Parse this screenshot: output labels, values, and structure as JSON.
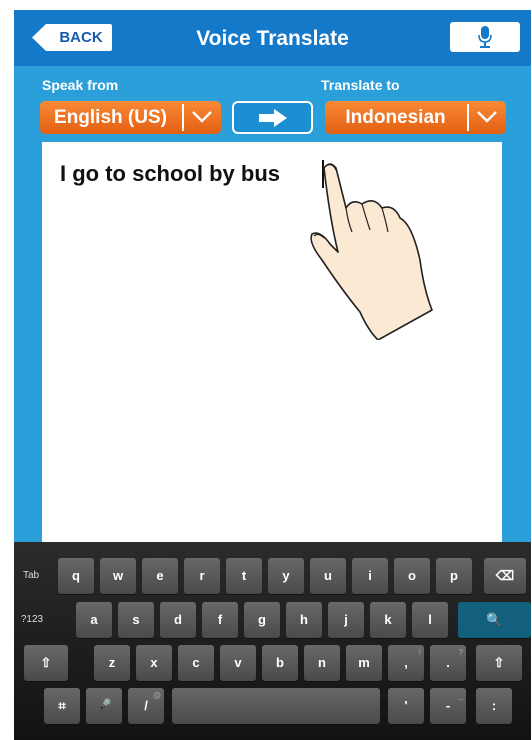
{
  "header": {
    "back_label": "BACK",
    "title": "Voice Translate",
    "mic_icon": "microphone-icon",
    "back_icon": "back-arrow-icon"
  },
  "languages": {
    "from_label": "Speak from",
    "to_label": "Translate to",
    "from_value": "English (US)",
    "to_value": "Indonesian",
    "swap_icon": "arrow-right-icon"
  },
  "input": {
    "text": "I go to school by bus"
  },
  "keyboard": {
    "row1": [
      "Tab",
      "q",
      "w",
      "e",
      "r",
      "t",
      "y",
      "u",
      "i",
      "o",
      "p",
      "⌫"
    ],
    "row2": [
      "?123",
      "a",
      "s",
      "d",
      "f",
      "g",
      "h",
      "j",
      "k",
      "l",
      "🔍"
    ],
    "row3": [
      "⇧",
      "z",
      "x",
      "c",
      "v",
      "b",
      "n",
      "m",
      ",",
      ".",
      "⇧"
    ],
    "row4": [
      "⌗",
      "🎤",
      "/",
      "",
      "'",
      "-",
      ":"
    ],
    "hints": {
      "comma": "!",
      "period": "?",
      "slash": "@",
      "dash": "_"
    }
  },
  "colors": {
    "background": "#2b9fd9",
    "header": "#1579c9",
    "dropdown": "#f2741f",
    "keyboard": "#1d1d1d"
  }
}
